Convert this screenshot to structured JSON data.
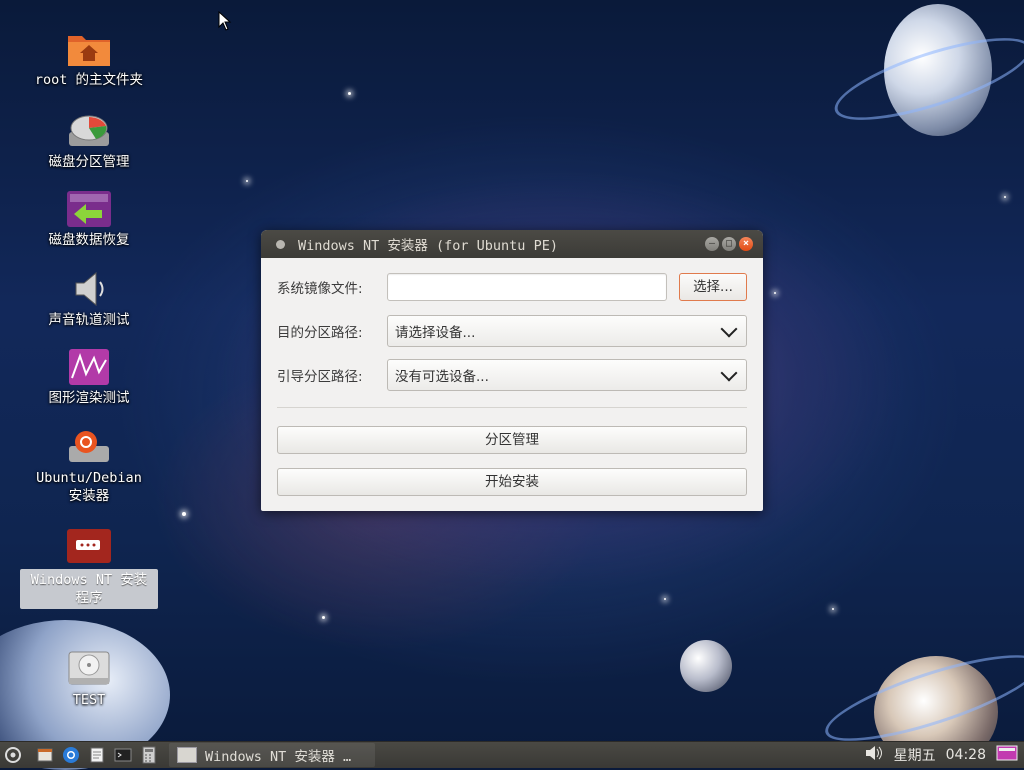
{
  "desktop": {
    "icons": [
      {
        "label": "root 的主文件夹"
      },
      {
        "label": "磁盘分区管理"
      },
      {
        "label": "磁盘数据恢复"
      },
      {
        "label": "声音轨道测试"
      },
      {
        "label": "图形渲染测试"
      },
      {
        "label": "Ubuntu/Debian\n安装器"
      },
      {
        "label": "Windows NT 安装\n程序"
      },
      {
        "label": "TEST"
      }
    ]
  },
  "window": {
    "title": "Windows NT 安装器 (for Ubuntu PE)",
    "image_label": "系统镜像文件:",
    "image_value": "",
    "select_button": "选择...",
    "target_label": "目的分区路径:",
    "target_value": "请选择设备...",
    "boot_label": "引导分区路径:",
    "boot_value": "没有可选设备...",
    "partition_button": "分区管理",
    "install_button": "开始安装"
  },
  "taskbar": {
    "task_label": "Windows NT 安装器 …",
    "day": "星期五",
    "time": "04:28"
  },
  "colors": {
    "accent_orange": "#e24a12",
    "titlebar": "#3c3b37",
    "window_bg": "#f2f1f0"
  }
}
